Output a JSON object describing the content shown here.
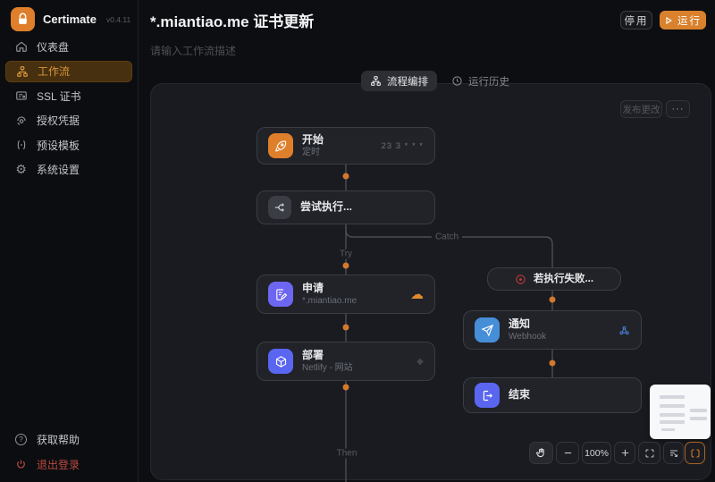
{
  "app": {
    "name": "Certimate",
    "version": "v0.4.11"
  },
  "sidebar": {
    "items": [
      {
        "label": "仪表盘"
      },
      {
        "label": "工作流"
      },
      {
        "label": "SSL 证书"
      },
      {
        "label": "授权凭据"
      },
      {
        "label": "预设模板"
      },
      {
        "label": "系统设置"
      }
    ],
    "help": "获取帮助",
    "logout": "退出登录"
  },
  "header": {
    "title": "*.miantiao.me 证书更新",
    "description": "请输入工作流描述",
    "disable_button": "停用",
    "run_button": "运行"
  },
  "tabs": {
    "design": "流程编排",
    "history": "运行历史"
  },
  "canvas": {
    "publish_button": "发布更改",
    "more_button": "···",
    "zoom_level": "100%"
  },
  "workflow": {
    "start": {
      "title": "开始",
      "subtitle": "定时",
      "cron": "23 3 * * *"
    },
    "trycatch": {
      "title": "尝试执行..."
    },
    "apply": {
      "title": "申请",
      "subtitle": "*.miantiao.me"
    },
    "deploy": {
      "title": "部署",
      "subtitle": "Netlify - 网站"
    },
    "fail": {
      "title": "若执行失败..."
    },
    "notify": {
      "title": "通知",
      "subtitle": "Webhook"
    },
    "end": {
      "title": "结束"
    },
    "labels": {
      "try": "Try",
      "catch": "Catch",
      "then": "Then"
    }
  },
  "colors": {
    "accent": "#d9812c",
    "edge": "#4a4e56",
    "dot": "#d4782e",
    "canvas": "#191b20"
  }
}
